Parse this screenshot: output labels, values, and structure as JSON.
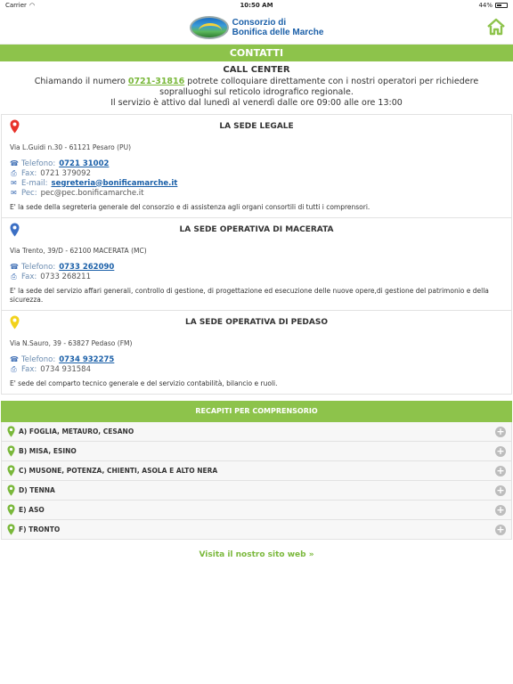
{
  "status": {
    "carrier": "Carrier",
    "time": "10:50 AM",
    "battery": "44%"
  },
  "header": {
    "logo_line1": "Consorzio di",
    "logo_line2": "Bonifica delle Marche"
  },
  "page_title": "CONTATTI",
  "call_center": {
    "title": "CALL CENTER",
    "text_before": "Chiamando il numero ",
    "number": "0721-31816",
    "text_after": " potrete colloquiare direttamente con i nostri operatori per richiedere sopralluoghi sul reticolo idrografico regionale.",
    "hours": "Il servizio è attivo dal lunedì al venerdì dalle ore 09:00 alle ore 13:00"
  },
  "sedi": [
    {
      "title": "LA SEDE LEGALE",
      "pin_color": "#e8332a",
      "address": "Via L.Guidi n.30 - 61121 Pesaro (PU)",
      "telefono_label": "Telefono: ",
      "telefono": "0721 31002",
      "fax_label": "Fax: ",
      "fax": "0721 379092",
      "email_label": "E-mail: ",
      "email": "segreteria@bonificamarche.it",
      "pec_label": "Pec: ",
      "pec": "pec@pec.bonificamarche.it",
      "description": "E' la sede della segreteria generale del consorzio e di assistenza agli organi consortili di tutti i comprensori."
    },
    {
      "title": "LA SEDE OPERATIVA DI MACERATA",
      "pin_color": "#3b6fc4",
      "address": "Via Trento, 39/D - 62100 MACERATA (MC)",
      "telefono_label": "Telefono: ",
      "telefono": "0733 262090",
      "fax_label": "Fax: ",
      "fax": "0733 268211",
      "description": "E' la sede del servizio affari generali, controllo di gestione, di progettazione ed esecuzione delle nuove opere,di gestione del patrimonio e della sicurezza."
    },
    {
      "title": "LA SEDE OPERATIVA DI PEDASO",
      "pin_color": "#f2d21b",
      "address": "Via N.Sauro, 39 - 63827 Pedaso (FM)",
      "telefono_label": "Telefono: ",
      "telefono": "0734 932275",
      "fax_label": "Fax: ",
      "fax": "0734 931584",
      "description": "E' sede del comparto tecnico generale e del servizio contabilità, bilancio e ruoli."
    }
  ],
  "recapiti": {
    "title": "RECAPITI PER COMPRENSORIO",
    "items": [
      "A) FOGLIA, METAURO, CESANO",
      "B) MISA, ESINO",
      "C) MUSONE, POTENZA, CHIENTI, ASOLA E ALTO NERA",
      "D) TENNA",
      "E) ASO",
      "F) TRONTO"
    ]
  },
  "visit_link": "Visita il nostro sito web »",
  "colors": {
    "accent": "#8dc34b",
    "link": "#1a5fa8"
  }
}
